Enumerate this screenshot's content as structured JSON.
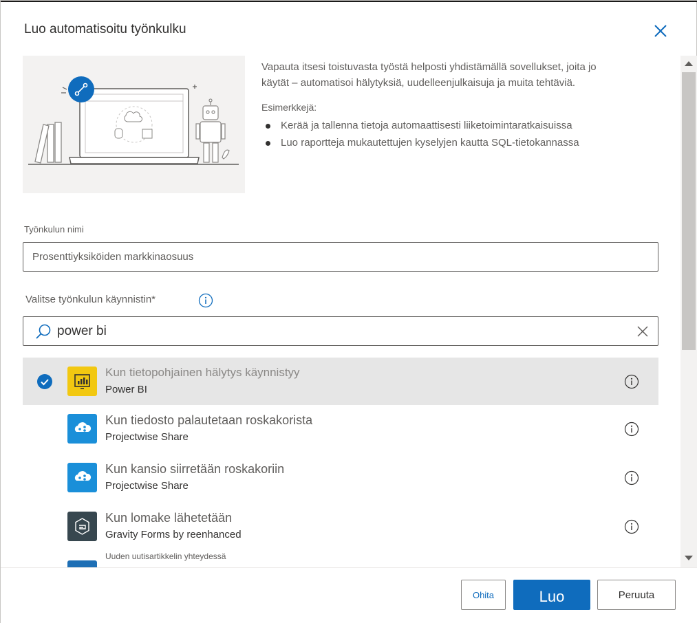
{
  "dialog": {
    "title": "Luo automatisoitu työnkulku"
  },
  "description": {
    "text": "Vapauta itsesi toistuvasta työstä helposti yhdistämällä sovellukset, joita jo käytät – automatisoi hälytyksiä, uudelleenjulkaisuja ja muita tehtäviä.",
    "examples_title": "Esimerkkejä:",
    "examples": [
      "Kerää ja tallenna tietoja automaattisesti liiketoimintaratkaisuissa",
      "Luo raportteja mukautettujen kyselyjen kautta SQL-tietokannassa"
    ]
  },
  "flow_name": {
    "label": "Työnkulun nimi",
    "value": "Prosenttiyksiköiden markkinaosuus"
  },
  "trigger": {
    "label": "Valitse työnkulun käynnistin*",
    "search_value": "power bi",
    "items": [
      {
        "title": "Kun tietopohjainen hälytys käynnistyy",
        "connector": "Power BI",
        "selected": true,
        "icon": "power-bi-icon",
        "color": "#f2c811"
      },
      {
        "title": "Kun tiedosto palautetaan roskakorista",
        "connector": "Projectwise Share",
        "selected": false,
        "icon": "projectwise-cloud-icon",
        "color": "#1a8fd9"
      },
      {
        "title": "Kun kansio siirretään roskakoriin",
        "connector": "Projectwise Share",
        "selected": false,
        "icon": "projectwise-cloud-icon",
        "color": "#1a8fd9"
      },
      {
        "title": "Kun lomake lähetetään",
        "connector": "Gravity Forms by reenhanced",
        "selected": false,
        "icon": "gravity-forms-icon",
        "color": "#37474f"
      },
      {
        "title": "Uuden uutisartikkelin yhteydessä",
        "connector": "",
        "selected": false,
        "icon": "news-icon",
        "color": "#1e6fb5"
      }
    ]
  },
  "footer": {
    "skip_label": "Ohita",
    "create_label": "Luo",
    "cancel_label": "Peruuta"
  },
  "colors": {
    "accent": "#0f6cbd",
    "selected_row": "#e6e6e6"
  }
}
